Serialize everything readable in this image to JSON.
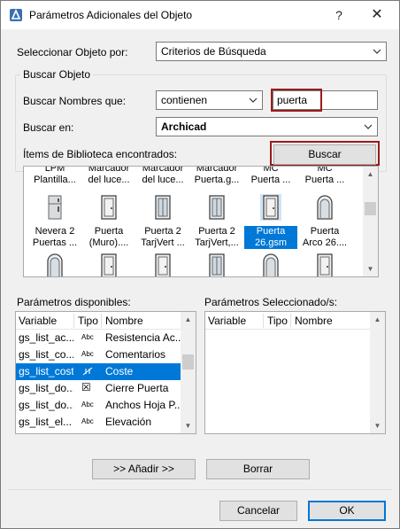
{
  "window": {
    "title": "Parámetros Adicionales del Objeto",
    "help": "?",
    "close": "✕",
    "app_icon": "archicad-icon"
  },
  "select_by": {
    "label": "Seleccionar Objeto por:",
    "value": "Criterios de Búsqueda"
  },
  "search": {
    "group_title": "Buscar Objeto",
    "names_label": "Buscar Nombres que:",
    "names_op": "contienen",
    "names_value": "puerta",
    "in_label": "Buscar en:",
    "in_value": "Archicad",
    "found_label": "Ítems de Biblioteca encontrados:",
    "search_button": "Buscar"
  },
  "library_items": [
    {
      "line1": "LPM",
      "line2": "Plantilla...",
      "icon": "template-icon"
    },
    {
      "line1": "Marcador",
      "line2": "del luce...",
      "icon": "marker-icon"
    },
    {
      "line1": "Marcador",
      "line2": "del luce...",
      "icon": "marker-icon"
    },
    {
      "line1": "Marcador",
      "line2": "Puerta.g...",
      "icon": "marker-icon"
    },
    {
      "line1": "MC",
      "line2": "Puerta ...",
      "icon": "marker-icon"
    },
    {
      "line1": "MC",
      "line2": "Puerta ...",
      "icon": "marker-icon"
    },
    {
      "line1": "Nevera 2",
      "line2": "Puertas ...",
      "icon": "fridge-icon"
    },
    {
      "line1": "Puerta",
      "line2": "(Muro)....",
      "icon": "door-icon"
    },
    {
      "line1": "Puerta 2",
      "line2": "TarjVert ...",
      "icon": "glass-door-icon"
    },
    {
      "line1": "Puerta 2",
      "line2": "TarjVert,...",
      "icon": "glass-door-icon"
    },
    {
      "line1": "Puerta",
      "line2": "26.gsm",
      "icon": "door-icon",
      "selected": true
    },
    {
      "line1": "Puerta",
      "line2": "Arco 26....",
      "icon": "arch-door-icon"
    },
    {
      "line1": "",
      "line2": "",
      "icon": "arch-door-icon"
    },
    {
      "line1": "",
      "line2": "",
      "icon": "door-icon"
    },
    {
      "line1": "",
      "line2": "",
      "icon": "door-icon"
    },
    {
      "line1": "",
      "line2": "",
      "icon": "glass-door-icon"
    },
    {
      "line1": "",
      "line2": "",
      "icon": "arch-door-icon"
    },
    {
      "line1": "",
      "line2": "",
      "icon": "door-icon"
    }
  ],
  "available": {
    "title": "Parámetros disponibles:",
    "headers": {
      "variable": "Variable",
      "tipo": "Tipo",
      "nombre": "Nombre"
    },
    "rows": [
      {
        "variable": "gs_list_ac...",
        "tipo": "Abc",
        "nombre": "Resistencia Ac..."
      },
      {
        "variable": "gs_list_co...",
        "tipo": "Abc",
        "nombre": "Comentarios"
      },
      {
        "variable": "gs_list_cost",
        "tipo": "cost-icon",
        "nombre": "Coste",
        "selected": true
      },
      {
        "variable": "gs_list_do...",
        "tipo": "☒",
        "nombre": "Cierre Puerta"
      },
      {
        "variable": "gs_list_do...",
        "tipo": "Abc",
        "nombre": "Anchos Hoja P..."
      },
      {
        "variable": "gs_list_el...",
        "tipo": "Abc",
        "nombre": "Elevación"
      }
    ]
  },
  "selected_params": {
    "title": "Parámetros Seleccionado/s:",
    "headers": {
      "variable": "Variable",
      "tipo": "Tipo",
      "nombre": "Nombre"
    }
  },
  "buttons": {
    "add": ">> Añadir >>",
    "remove": "Borrar",
    "cancel": "Cancelar",
    "ok": "OK"
  },
  "colors": {
    "accent": "#0078d7",
    "highlight_outline": "#9b1b1b"
  }
}
